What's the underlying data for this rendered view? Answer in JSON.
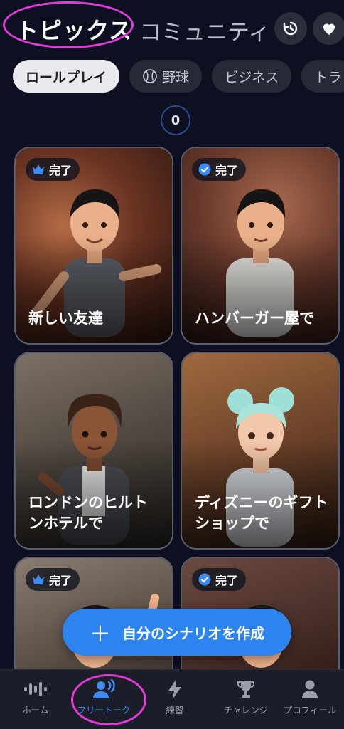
{
  "header": {
    "tab_topics": "トピックス",
    "tab_community": "コミュニティ",
    "history_icon": "history-icon",
    "heart_icon": "heart-icon"
  },
  "chips": [
    {
      "label": "ロールプレイ",
      "active": true
    },
    {
      "label": "野球",
      "icon": "baseball-icon"
    },
    {
      "label": "ビジネス"
    },
    {
      "label": "トラ"
    }
  ],
  "counter": "0",
  "cards": [
    {
      "title": "新しい友達",
      "badge": "完了",
      "badge_icon": "crown-icon"
    },
    {
      "title": "ハンバーガー屋で",
      "badge": "完了",
      "badge_icon": "check-circle-icon"
    },
    {
      "title": "ロンドンのヒルトンホテルで",
      "badge": "",
      "badge_icon": ""
    },
    {
      "title": "ディズニーのギフトショップで",
      "badge": "",
      "badge_icon": ""
    },
    {
      "title": "",
      "badge": "完了",
      "badge_icon": "crown-icon"
    },
    {
      "title": "",
      "badge": "完了",
      "badge_icon": "check-circle-icon"
    }
  ],
  "create_button": {
    "label": "自分のシナリオを作成",
    "icon": "plus-icon"
  },
  "nav": [
    {
      "label": "ホーム",
      "icon": "waveform-icon"
    },
    {
      "label": "フリートーク",
      "icon": "speaking-person-icon",
      "active": true
    },
    {
      "label": "練習",
      "icon": "lightning-icon"
    },
    {
      "label": "チャレンジ",
      "icon": "trophy-icon"
    },
    {
      "label": "プロフィール",
      "icon": "person-icon"
    }
  ],
  "colors": {
    "accent": "#2b84f0",
    "annotation": "#e23bd9",
    "background": "#0c1020"
  }
}
